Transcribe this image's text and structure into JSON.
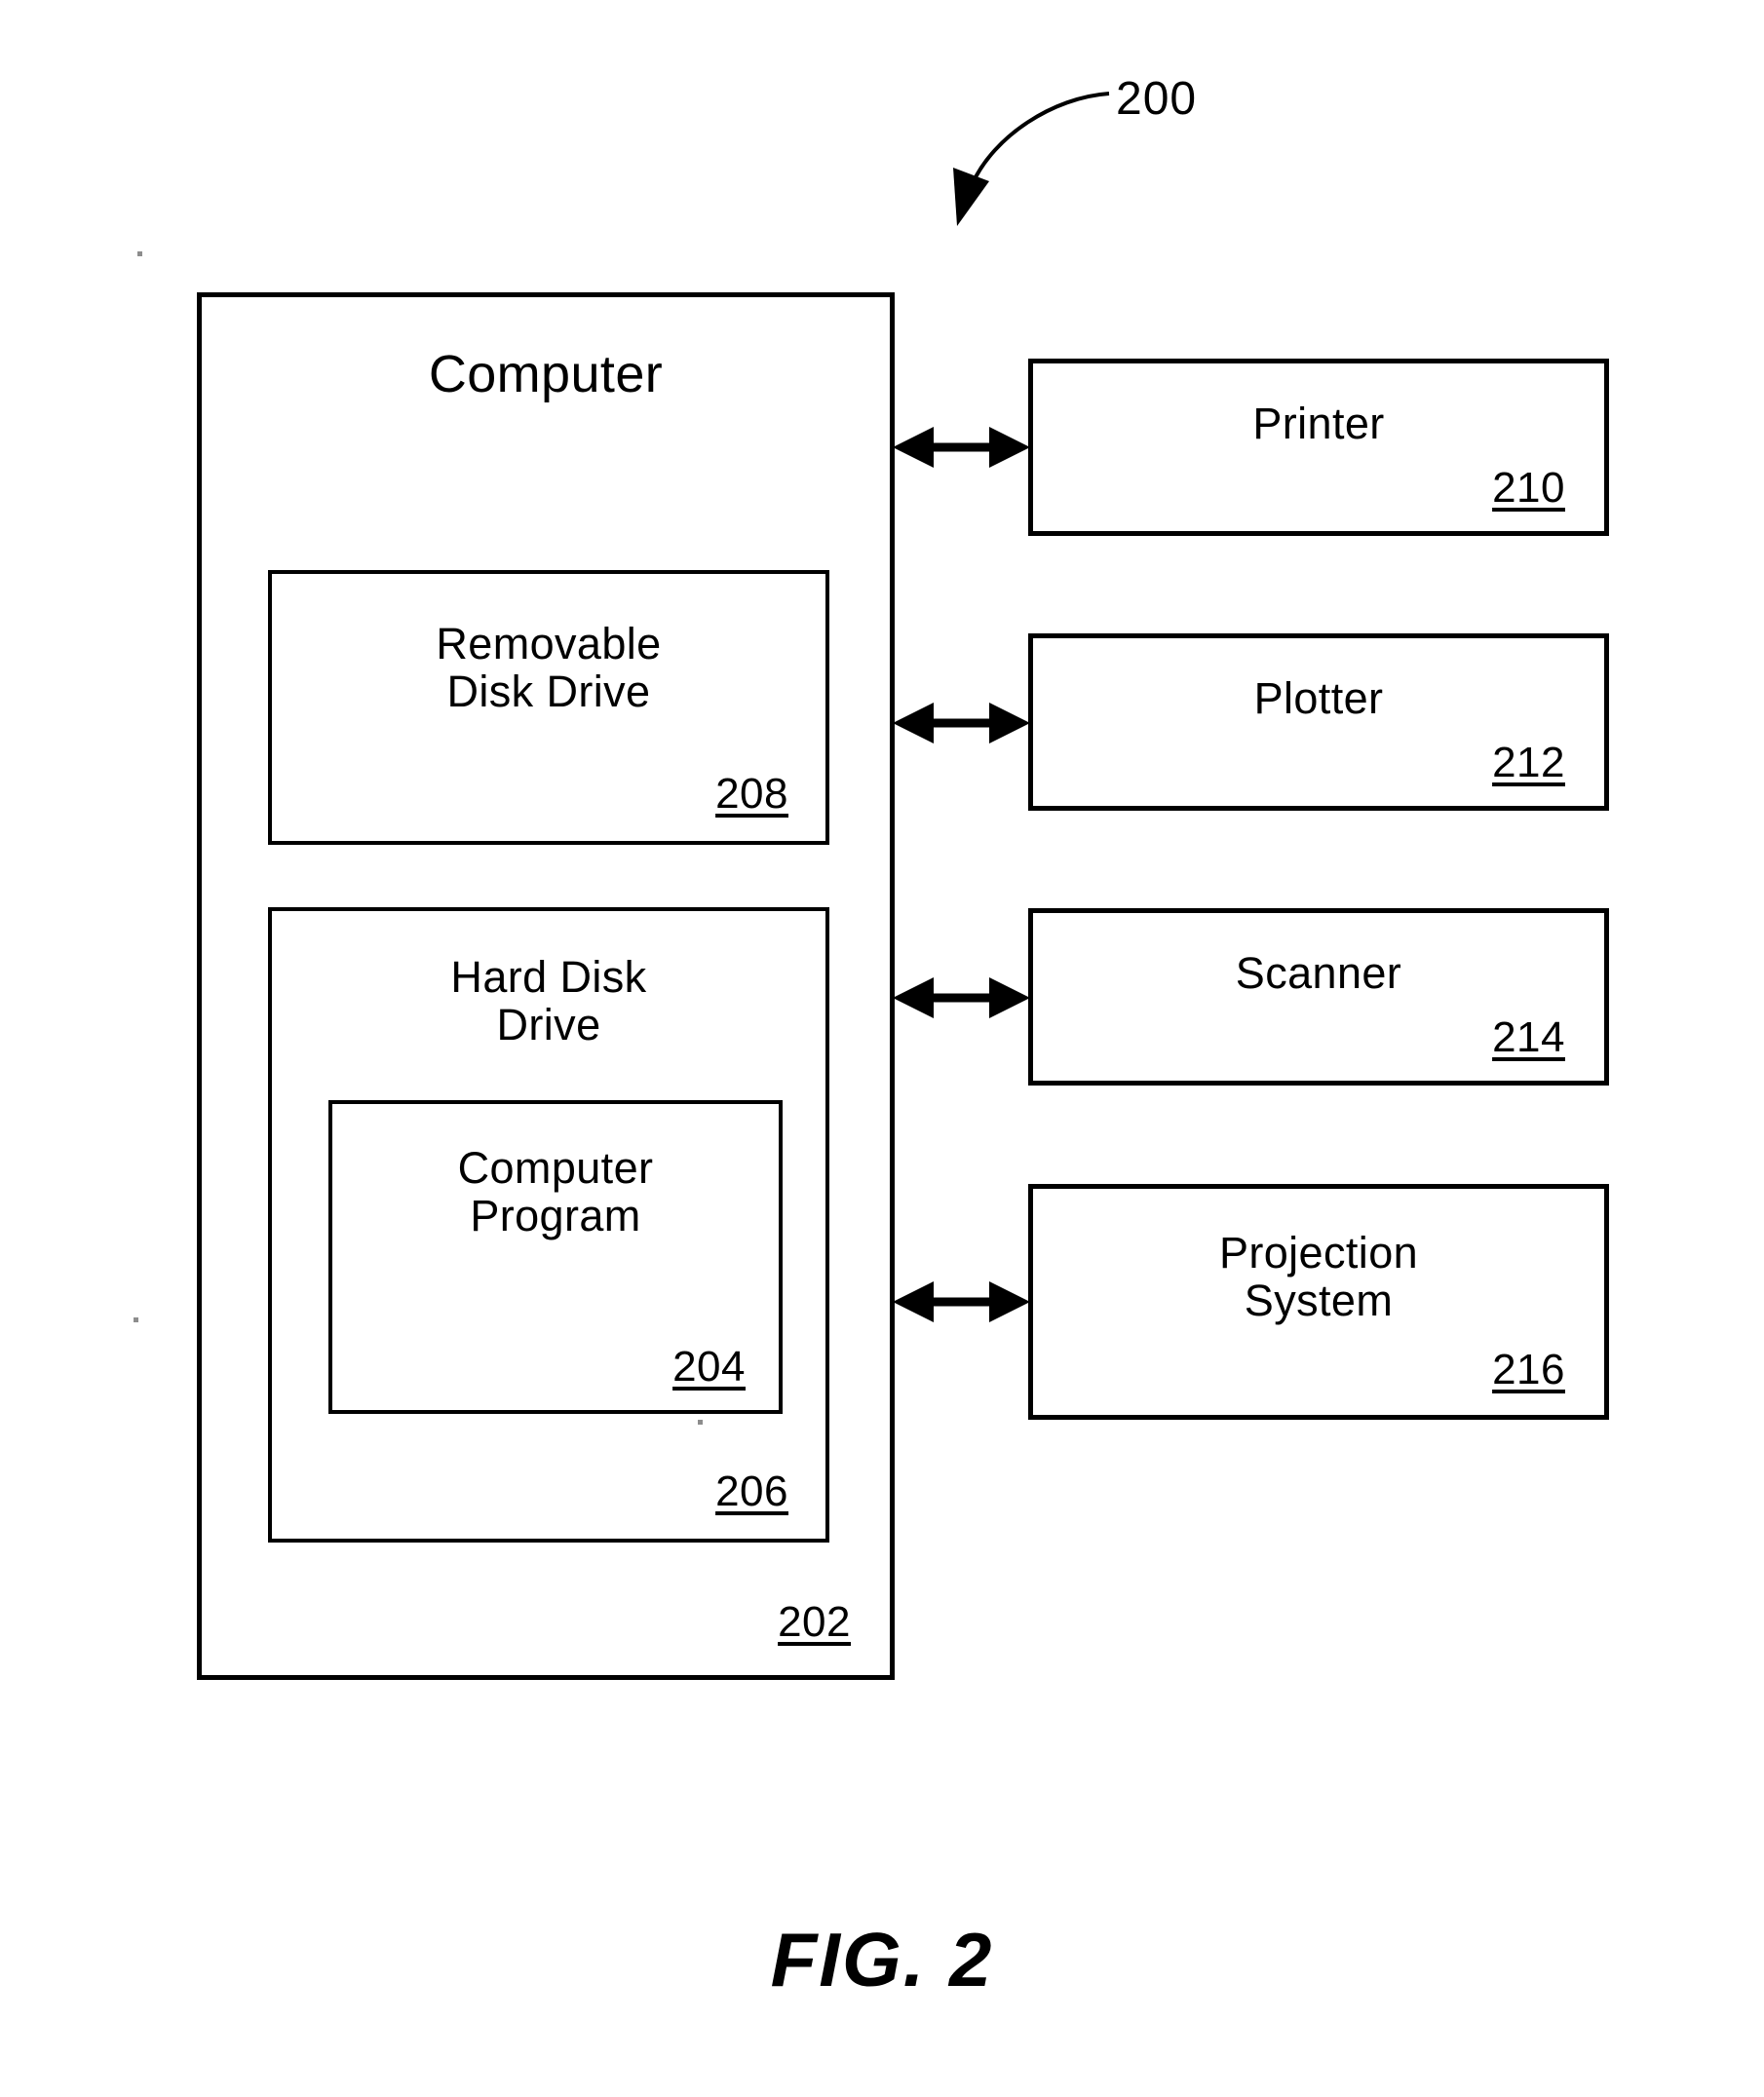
{
  "figure": {
    "id_label": "200",
    "caption": "FIG. 2"
  },
  "computer": {
    "title": "Computer",
    "ref": "202",
    "children": {
      "removable_disk_drive": {
        "title": "Removable\nDisk Drive",
        "ref": "208"
      },
      "hard_disk_drive": {
        "title": "Hard Disk\nDrive",
        "ref": "206",
        "children": {
          "computer_program": {
            "title": "Computer\nProgram",
            "ref": "204"
          }
        }
      }
    }
  },
  "peripherals": [
    {
      "title": "Printer",
      "ref": "210"
    },
    {
      "title": "Plotter",
      "ref": "212"
    },
    {
      "title": "Scanner",
      "ref": "214"
    },
    {
      "title": "Projection\nSystem",
      "ref": "216"
    }
  ],
  "connectors": [
    {
      "from": "computer",
      "to": "printer",
      "style": "bidirectional"
    },
    {
      "from": "computer",
      "to": "plotter",
      "style": "bidirectional"
    },
    {
      "from": "computer",
      "to": "scanner",
      "style": "bidirectional"
    },
    {
      "from": "computer",
      "to": "projection-system",
      "style": "bidirectional"
    }
  ],
  "colors": {
    "ink": "#000000",
    "paper": "#ffffff"
  }
}
